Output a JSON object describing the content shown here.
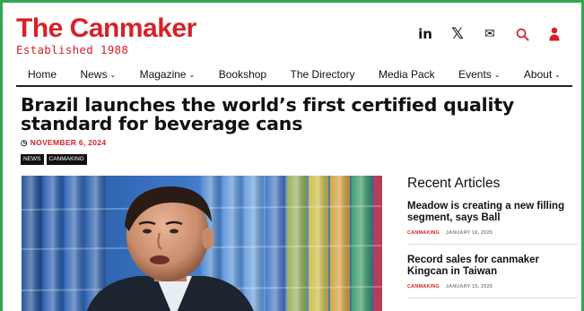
{
  "brand": {
    "title": "The Canmaker",
    "subtitle": "Established 1988"
  },
  "header_icons": [
    {
      "name": "linkedin-icon",
      "glyph": "in"
    },
    {
      "name": "x-icon",
      "glyph": "𝕏"
    },
    {
      "name": "mail-icon",
      "glyph": "✉"
    },
    {
      "name": "search-icon",
      "glyph": "⚲"
    },
    {
      "name": "user-icon",
      "glyph": "👤"
    }
  ],
  "nav": {
    "home": "Home",
    "news": "News",
    "magazine": "Magazine",
    "bookshop": "Bookshop",
    "directory": "The Directory",
    "media_pack": "Media Pack",
    "events": "Events",
    "about": "About"
  },
  "article": {
    "headline": "Brazil launches the world’s first certified quality standard for beverage cans",
    "date": "NOVEMBER 6, 2024",
    "tags": [
      "NEWS",
      "CANMAKING"
    ]
  },
  "sidebar": {
    "title": "Recent Articles",
    "items": [
      {
        "title": "Meadow is creating a new filling segment, says Ball",
        "category": "CANMAKING",
        "date": "JANUARY 16, 2025"
      },
      {
        "title": "Record sales for canmaker Kingcan in Taiwan",
        "category": "CANMAKING",
        "date": "JANUARY 15, 2025"
      }
    ]
  },
  "colors": {
    "brand_red": "#d6212a",
    "frame_green": "#2fa84f"
  }
}
